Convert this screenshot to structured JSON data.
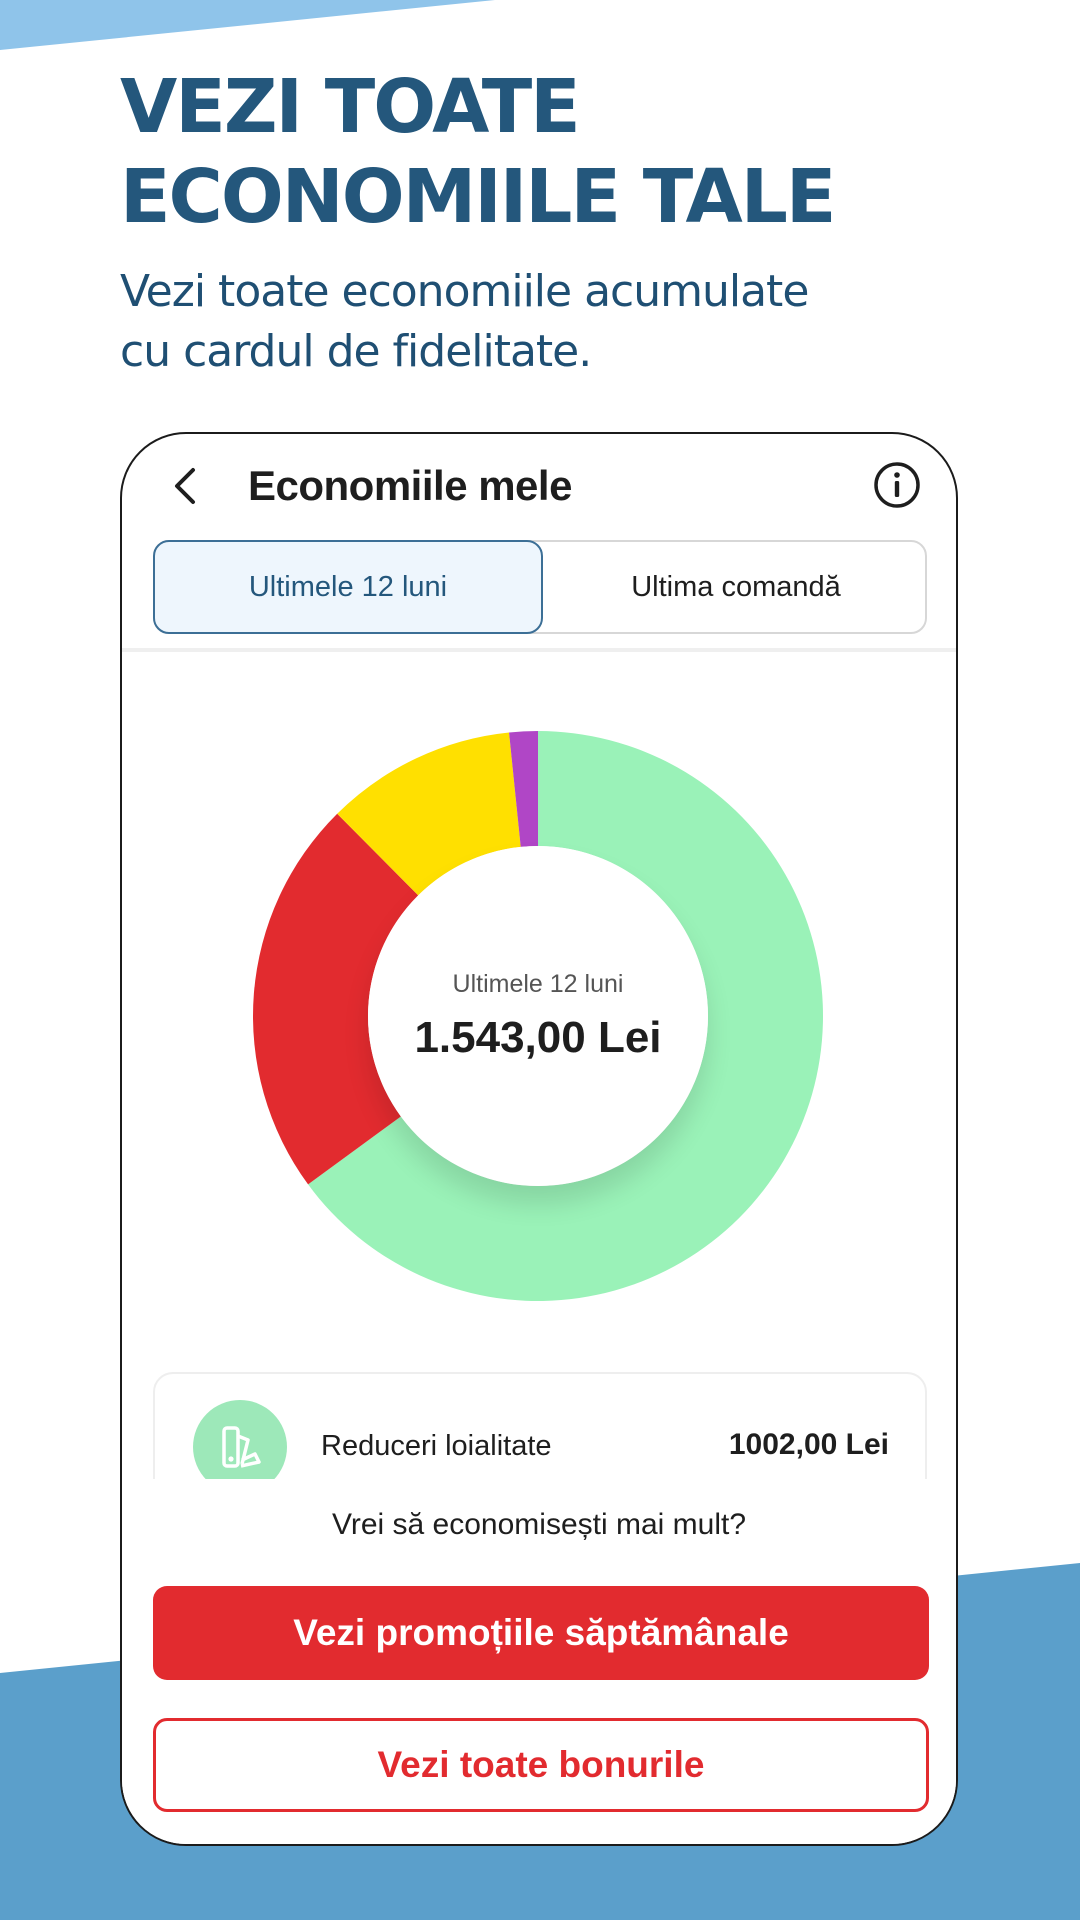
{
  "colors": {
    "brand_blue": "#24577c",
    "deco_light_blue": "#8fc4ea",
    "deco_blue": "#5b9fcb",
    "primary_red": "#e22b2f",
    "segment_green": "#9af2b8",
    "segment_red": "#e22b2f",
    "segment_yellow": "#ffe000",
    "segment_purple": "#b046c6"
  },
  "promo": {
    "headline_line1": "VEZI TOATE",
    "headline_line2": "ECONOMIILE TALE",
    "subtitle_line1": "Vezi toate economiile acumulate",
    "subtitle_line2": "cu cardul de fidelitate."
  },
  "app": {
    "header": {
      "title": "Economiile mele",
      "back_icon": "chevron-left-icon",
      "info_icon": "info-circle-icon"
    },
    "tabs": [
      {
        "label": "Ultimele 12 luni",
        "selected": true
      },
      {
        "label": "Ultima comandă",
        "selected": false
      }
    ],
    "summary": {
      "label": "Ultimele 12 luni",
      "total": "1.543,00 Lei"
    },
    "breakdown": [
      {
        "label": "Reduceri loialitate",
        "value": "1002,00 Lei",
        "icon": "color-swatch-icon"
      }
    ],
    "prompt": "Vrei să economisești mai mult?",
    "primary_button": "Vezi promoțiile săptămânale",
    "secondary_button": "Vezi toate bonurile"
  },
  "chart_data": {
    "type": "pie",
    "variant": "donut",
    "total": 1543,
    "segments": [
      {
        "value": 1002,
        "color": "#9af2b8"
      },
      {
        "value": 349,
        "color": "#e22b2f"
      },
      {
        "value": 167,
        "color": "#ffe000"
      },
      {
        "value": 25,
        "color": "#b046c6"
      }
    ]
  }
}
